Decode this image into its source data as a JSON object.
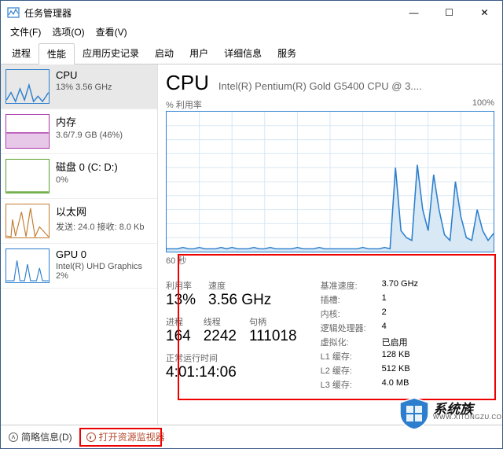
{
  "window": {
    "title": "任务管理器"
  },
  "menu": {
    "file": "文件(F)",
    "options": "选项(O)",
    "view": "查看(V)"
  },
  "tabs": {
    "processes": "进程",
    "performance": "性能",
    "appHistory": "应用历史记录",
    "startup": "启动",
    "users": "用户",
    "details": "详细信息",
    "services": "服务"
  },
  "sidebar": {
    "cpu": {
      "name": "CPU",
      "sub": "13% 3.56 GHz"
    },
    "memory": {
      "name": "内存",
      "sub": "3.6/7.9 GB (46%)"
    },
    "disk": {
      "name": "磁盘 0 (C: D:)",
      "sub": "0%"
    },
    "ethernet": {
      "name": "以太网",
      "sub": "发送: 24.0 接收: 8.0 Kb"
    },
    "gpu": {
      "name": "GPU 0",
      "sub1": "Intel(R) UHD Graphics",
      "sub2": "2%"
    }
  },
  "main": {
    "title": "CPU",
    "subtitle": "Intel(R) Pentium(R) Gold G5400 CPU @ 3....",
    "utilLabel": "% 利用率",
    "scaleMax": "100%",
    "timeLabel": "60 秒",
    "details": {
      "utilLabel": "利用率",
      "util": "13%",
      "speedLabel": "速度",
      "speed": "3.56 GHz",
      "procLabel": "进程",
      "proc": "164",
      "threadLabel": "线程",
      "thread": "2242",
      "handleLabel": "句柄",
      "handle": "111018",
      "uptimeLabel": "正常运行时间",
      "uptime": "4:01:14:06"
    },
    "specs": {
      "baseSpeedLabel": "基准速度:",
      "baseSpeed": "3.70 GHz",
      "socketsLabel": "插槽:",
      "sockets": "1",
      "coresLabel": "内核:",
      "cores": "2",
      "logicalLabel": "逻辑处理器:",
      "logical": "4",
      "virtLabel": "虚拟化:",
      "virt": "已启用",
      "l1Label": "L1 缓存:",
      "l1": "128 KB",
      "l2Label": "L2 缓存:",
      "l2": "512 KB",
      "l3Label": "L3 缓存:",
      "l3": "4.0 MB"
    }
  },
  "bottom": {
    "brief": "简略信息(D)",
    "resmon": "打开资源监视器"
  },
  "watermark": {
    "text": "系统族",
    "url": "WWW.XITONGZU.COM"
  },
  "chart_data": {
    "type": "area",
    "title": "% 利用率",
    "ylim": [
      0,
      100
    ],
    "x_range_seconds": 60,
    "values": [
      2,
      2,
      2,
      3,
      2,
      2,
      3,
      2,
      2,
      2,
      3,
      2,
      3,
      2,
      2,
      2,
      3,
      2,
      2,
      3,
      2,
      2,
      2,
      2,
      3,
      2,
      2,
      2,
      3,
      2,
      2,
      2,
      2,
      2,
      2,
      2,
      3,
      2,
      2,
      2,
      3,
      2,
      60,
      15,
      10,
      8,
      62,
      30,
      15,
      55,
      30,
      12,
      8,
      50,
      25,
      10,
      8,
      30,
      15,
      8,
      13
    ]
  }
}
